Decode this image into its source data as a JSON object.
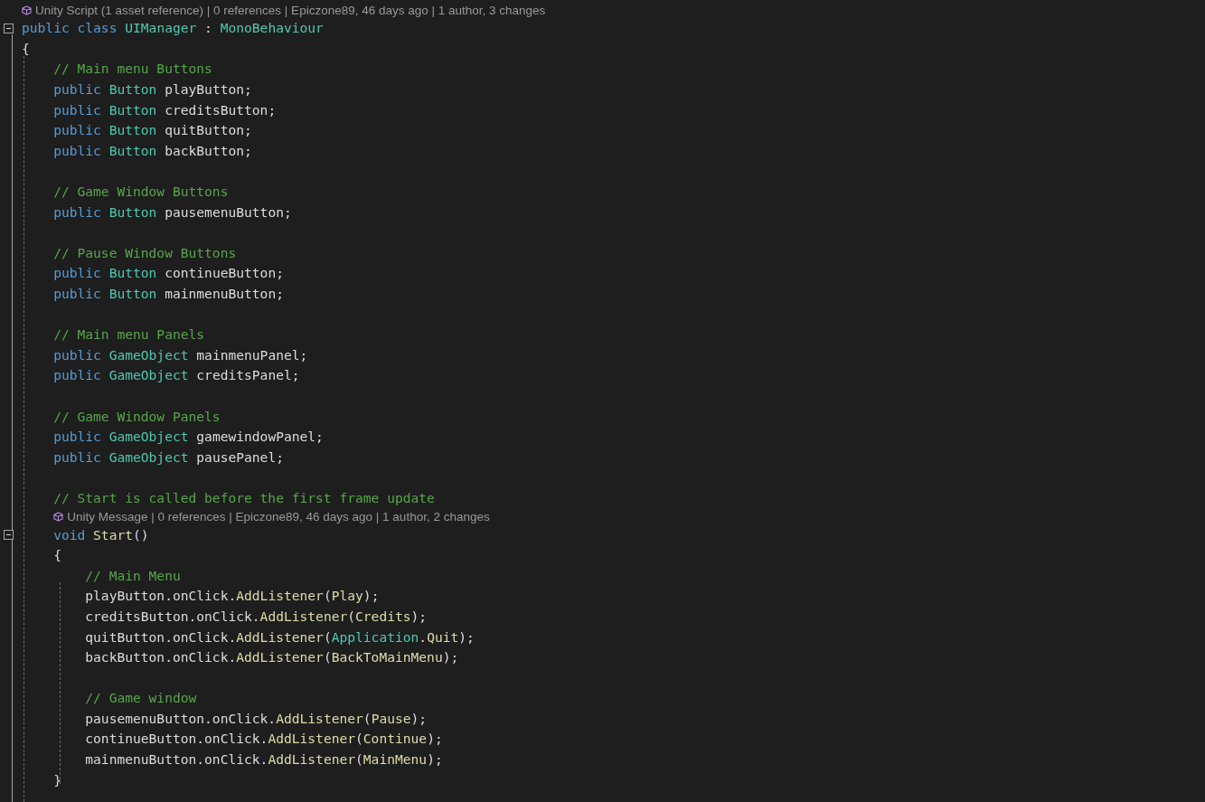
{
  "lines": [
    {
      "kind": "code",
      "lens": "Unity Script (1 asset reference) | 0 references | Epiczone89, 46 days ago | 1 author, 3 changes",
      "expanded": true,
      "tokens": [
        {
          "kind": "keyword",
          "text": "public class "
        },
        {
          "kind": "class",
          "text": "UIManager"
        },
        {
          "kind": "plain",
          "text": " : "
        },
        {
          "kind": "class",
          "text": "MonoBehaviour"
        }
      ]
    },
    {
      "kind": "code",
      "tokens": [
        {
          "kind": "plain",
          "text": "{"
        }
      ]
    },
    {
      "kind": "code",
      "tokens": [
        {
          "kind": "comment",
          "text": "    // Main menu Buttons"
        }
      ]
    },
    {
      "kind": "code",
      "tokens": [
        {
          "kind": "keyword",
          "text": "    public "
        },
        {
          "kind": "class",
          "text": "Button"
        },
        {
          "kind": "plain",
          "text": " playButton;"
        }
      ]
    },
    {
      "kind": "code",
      "tokens": [
        {
          "kind": "keyword",
          "text": "    public "
        },
        {
          "kind": "class",
          "text": "Button"
        },
        {
          "kind": "plain",
          "text": " creditsButton;"
        }
      ]
    },
    {
      "kind": "code",
      "tokens": [
        {
          "kind": "keyword",
          "text": "    public "
        },
        {
          "kind": "class",
          "text": "Button"
        },
        {
          "kind": "plain",
          "text": " quitButton;"
        }
      ]
    },
    {
      "kind": "code",
      "tokens": [
        {
          "kind": "keyword",
          "text": "    public "
        },
        {
          "kind": "class",
          "text": "Button"
        },
        {
          "kind": "plain",
          "text": " backButton;"
        }
      ]
    },
    {
      "kind": "blank"
    },
    {
      "kind": "code",
      "tokens": [
        {
          "kind": "comment",
          "text": "    // Game Window Buttons"
        }
      ]
    },
    {
      "kind": "code",
      "tokens": [
        {
          "kind": "keyword",
          "text": "    public "
        },
        {
          "kind": "class",
          "text": "Button"
        },
        {
          "kind": "plain",
          "text": " pausemenuButton;"
        }
      ]
    },
    {
      "kind": "blank"
    },
    {
      "kind": "code",
      "tokens": [
        {
          "kind": "comment",
          "text": "    // Pause Window Buttons"
        }
      ]
    },
    {
      "kind": "code",
      "tokens": [
        {
          "kind": "keyword",
          "text": "    public "
        },
        {
          "kind": "class",
          "text": "Button"
        },
        {
          "kind": "plain",
          "text": " continueButton;"
        }
      ]
    },
    {
      "kind": "code",
      "tokens": [
        {
          "kind": "keyword",
          "text": "    public "
        },
        {
          "kind": "class",
          "text": "Button"
        },
        {
          "kind": "plain",
          "text": " mainmenuButton;"
        }
      ]
    },
    {
      "kind": "blank"
    },
    {
      "kind": "code",
      "tokens": [
        {
          "kind": "comment",
          "text": "    // Main menu Panels"
        }
      ]
    },
    {
      "kind": "code",
      "tokens": [
        {
          "kind": "keyword",
          "text": "    public "
        },
        {
          "kind": "class",
          "text": "GameObject"
        },
        {
          "kind": "plain",
          "text": " mainmenuPanel;"
        }
      ]
    },
    {
      "kind": "code",
      "tokens": [
        {
          "kind": "keyword",
          "text": "    public "
        },
        {
          "kind": "class",
          "text": "GameObject"
        },
        {
          "kind": "plain",
          "text": " creditsPanel;"
        }
      ]
    },
    {
      "kind": "blank"
    },
    {
      "kind": "code",
      "tokens": [
        {
          "kind": "comment",
          "text": "    // Game Window Panels"
        }
      ]
    },
    {
      "kind": "code",
      "tokens": [
        {
          "kind": "keyword",
          "text": "    public "
        },
        {
          "kind": "class",
          "text": "GameObject"
        },
        {
          "kind": "plain",
          "text": " gamewindowPanel;"
        }
      ]
    },
    {
      "kind": "code",
      "tokens": [
        {
          "kind": "keyword",
          "text": "    public "
        },
        {
          "kind": "class",
          "text": "GameObject"
        },
        {
          "kind": "plain",
          "text": " pausePanel;"
        }
      ]
    },
    {
      "kind": "blank"
    },
    {
      "kind": "code",
      "tokens": [
        {
          "kind": "comment",
          "text": "    // Start is called before the first frame update"
        }
      ]
    },
    {
      "kind": "code",
      "lens": "Unity Message | 0 references | Epiczone89, 46 days ago | 1 author, 2 changes",
      "expanded": true,
      "tokens": [
        {
          "kind": "keyword",
          "text": "    void "
        },
        {
          "kind": "method",
          "text": "Start"
        },
        {
          "kind": "plain",
          "text": "()"
        }
      ]
    },
    {
      "kind": "code",
      "tokens": [
        {
          "kind": "plain",
          "text": "    {"
        }
      ]
    },
    {
      "kind": "code",
      "tokens": [
        {
          "kind": "comment",
          "text": "        // Main Menu"
        }
      ]
    },
    {
      "kind": "code",
      "tokens": [
        {
          "kind": "plain",
          "text": "        playButton.onClick."
        },
        {
          "kind": "method",
          "text": "AddListener"
        },
        {
          "kind": "plain",
          "text": "("
        },
        {
          "kind": "method",
          "text": "Play"
        },
        {
          "kind": "plain",
          "text": ");"
        }
      ]
    },
    {
      "kind": "code",
      "tokens": [
        {
          "kind": "plain",
          "text": "        creditsButton.onClick."
        },
        {
          "kind": "method",
          "text": "AddListener"
        },
        {
          "kind": "plain",
          "text": "("
        },
        {
          "kind": "method",
          "text": "Credits"
        },
        {
          "kind": "plain",
          "text": ");"
        }
      ]
    },
    {
      "kind": "code",
      "tokens": [
        {
          "kind": "plain",
          "text": "        quitButton.onClick."
        },
        {
          "kind": "method",
          "text": "AddListener"
        },
        {
          "kind": "plain",
          "text": "("
        },
        {
          "kind": "class",
          "text": "Application"
        },
        {
          "kind": "plain",
          "text": "."
        },
        {
          "kind": "method",
          "text": "Quit"
        },
        {
          "kind": "plain",
          "text": ");"
        }
      ]
    },
    {
      "kind": "code",
      "tokens": [
        {
          "kind": "plain",
          "text": "        backButton.onClick."
        },
        {
          "kind": "method",
          "text": "AddListener"
        },
        {
          "kind": "plain",
          "text": "("
        },
        {
          "kind": "method",
          "text": "BackToMainMenu"
        },
        {
          "kind": "plain",
          "text": ");"
        }
      ]
    },
    {
      "kind": "blank"
    },
    {
      "kind": "code",
      "tokens": [
        {
          "kind": "comment",
          "text": "        // Game window"
        }
      ]
    },
    {
      "kind": "code",
      "tokens": [
        {
          "kind": "plain",
          "text": "        pausemenuButton.onClick."
        },
        {
          "kind": "method",
          "text": "AddListener"
        },
        {
          "kind": "plain",
          "text": "("
        },
        {
          "kind": "method",
          "text": "Pause"
        },
        {
          "kind": "plain",
          "text": ");"
        }
      ]
    },
    {
      "kind": "code",
      "tokens": [
        {
          "kind": "plain",
          "text": "        continueButton.onClick."
        },
        {
          "kind": "method",
          "text": "AddListener"
        },
        {
          "kind": "plain",
          "text": "("
        },
        {
          "kind": "method",
          "text": "Continue"
        },
        {
          "kind": "plain",
          "text": ");"
        }
      ]
    },
    {
      "kind": "code",
      "tokens": [
        {
          "kind": "plain",
          "text": "        mainmenuButton.onClick."
        },
        {
          "kind": "method",
          "text": "AddListener"
        },
        {
          "kind": "plain",
          "text": "("
        },
        {
          "kind": "method",
          "text": "MainMenu"
        },
        {
          "kind": "plain",
          "text": ");"
        }
      ]
    },
    {
      "kind": "code",
      "tokens": [
        {
          "kind": "plain",
          "text": "    }"
        }
      ]
    },
    {
      "kind": "blank"
    }
  ]
}
